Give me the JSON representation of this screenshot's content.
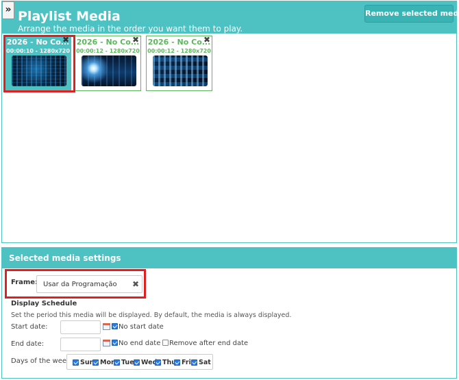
{
  "playlist": {
    "toggle_icon": "»",
    "title": "Playlist Media",
    "subtitle": "Arrange the media in the order you want them to play.",
    "remove_button": "Remove selected media",
    "items": [
      {
        "name": "2026 - No Co...",
        "meta": "00:00:10 - 1280x720",
        "selected": true
      },
      {
        "name": "2026 - No Co...",
        "meta": "00:00:12 - 1280x720",
        "selected": false
      },
      {
        "name": "2026 - No Co...",
        "meta": "00:00:12 - 1280x720",
        "selected": false
      }
    ],
    "close_icon": "✖"
  },
  "settings": {
    "title": "Selected media settings",
    "frame_label": "Frame:",
    "frame_value": "Usar da Programação",
    "frame_clear_icon": "✖",
    "schedule_title": "Display Schedule",
    "schedule_desc": "Set the period this media will be displayed. By default, the media is always displayed.",
    "start_label": "Start date:",
    "no_start_label": "No start date",
    "end_label": "End date:",
    "no_end_label": "No end date",
    "remove_after_label": "Remove after end date",
    "days_label": "Days of the week:",
    "days": [
      "Sun",
      "Mon",
      "Tue",
      "Wed",
      "Thu",
      "Fri",
      "Sat"
    ]
  },
  "colors": {
    "accent": "#4ec1c3",
    "card_text": "#5cb85c",
    "highlight": "#e02020"
  }
}
